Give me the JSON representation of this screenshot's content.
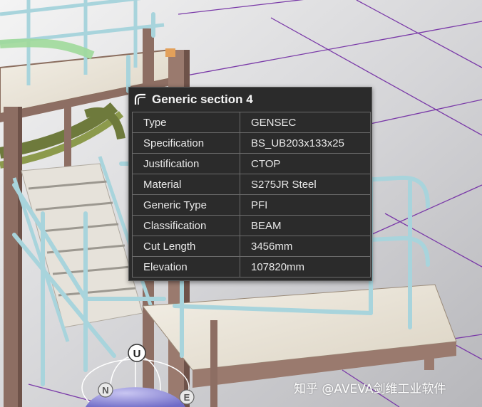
{
  "tooltip": {
    "title": "Generic section 4",
    "icon": "generic-section-icon",
    "rows": [
      {
        "key": "Type",
        "value": "GENSEC"
      },
      {
        "key": "Specification",
        "value": "BS_UB203x133x25"
      },
      {
        "key": "Justification",
        "value": "CTOP"
      },
      {
        "key": "Material",
        "value": "S275JR Steel"
      },
      {
        "key": "Generic Type",
        "value": "PFI"
      },
      {
        "key": "Classification",
        "value": "BEAM"
      },
      {
        "key": "Cut Length",
        "value": "3456mm"
      },
      {
        "key": "Elevation",
        "value": "107820mm"
      }
    ]
  },
  "compass": {
    "up_label": "U",
    "north_label": "N",
    "east_label": "E"
  },
  "watermark": "知乎 @AVEVA剑维工业软件",
  "colors": {
    "tooltip_bg": "#2b2b2b",
    "steel": "#8d6e63",
    "railing": "#a8d4dc",
    "grid": "#7a3aa8",
    "pipe": "#6e7a3c",
    "floor": "#ece6da"
  }
}
